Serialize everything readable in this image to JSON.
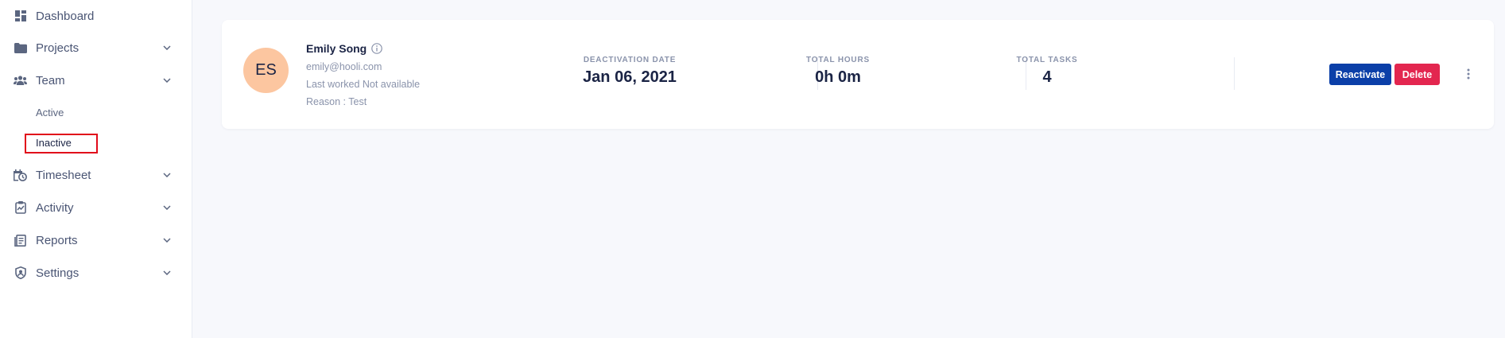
{
  "sidebar": {
    "items": [
      {
        "label": "Dashboard",
        "icon": "dashboard-icon"
      },
      {
        "label": "Projects",
        "icon": "folder-icon",
        "expandable": true
      },
      {
        "label": "Team",
        "icon": "team-icon",
        "expandable": true
      },
      {
        "label": "Timesheet",
        "icon": "timesheet-icon",
        "expandable": true
      },
      {
        "label": "Activity",
        "icon": "activity-icon",
        "expandable": true
      },
      {
        "label": "Reports",
        "icon": "reports-icon",
        "expandable": true
      },
      {
        "label": "Settings",
        "icon": "settings-icon",
        "expandable": true
      }
    ],
    "team_subitems": [
      {
        "label": "Active"
      },
      {
        "label": "Inactive",
        "selected": true
      }
    ]
  },
  "member_card": {
    "avatar_initials": "ES",
    "name": "Emily Song",
    "email": "emily@hooli.com",
    "last_worked": "Last worked Not available",
    "reason": "Reason : Test",
    "stats": [
      {
        "label": "DEACTIVATION DATE",
        "value": "Jan 06, 2021"
      },
      {
        "label": "TOTAL HOURS",
        "value": "0h 0m"
      },
      {
        "label": "TOTAL TASKS",
        "value": "4"
      }
    ],
    "actions": {
      "reactivate_label": "Reactivate",
      "delete_label": "Delete"
    }
  },
  "colors": {
    "primary": "#0b3fa8",
    "danger": "#e3264f",
    "avatar_bg": "#fcc6a0",
    "highlight": "#e10a1a"
  }
}
